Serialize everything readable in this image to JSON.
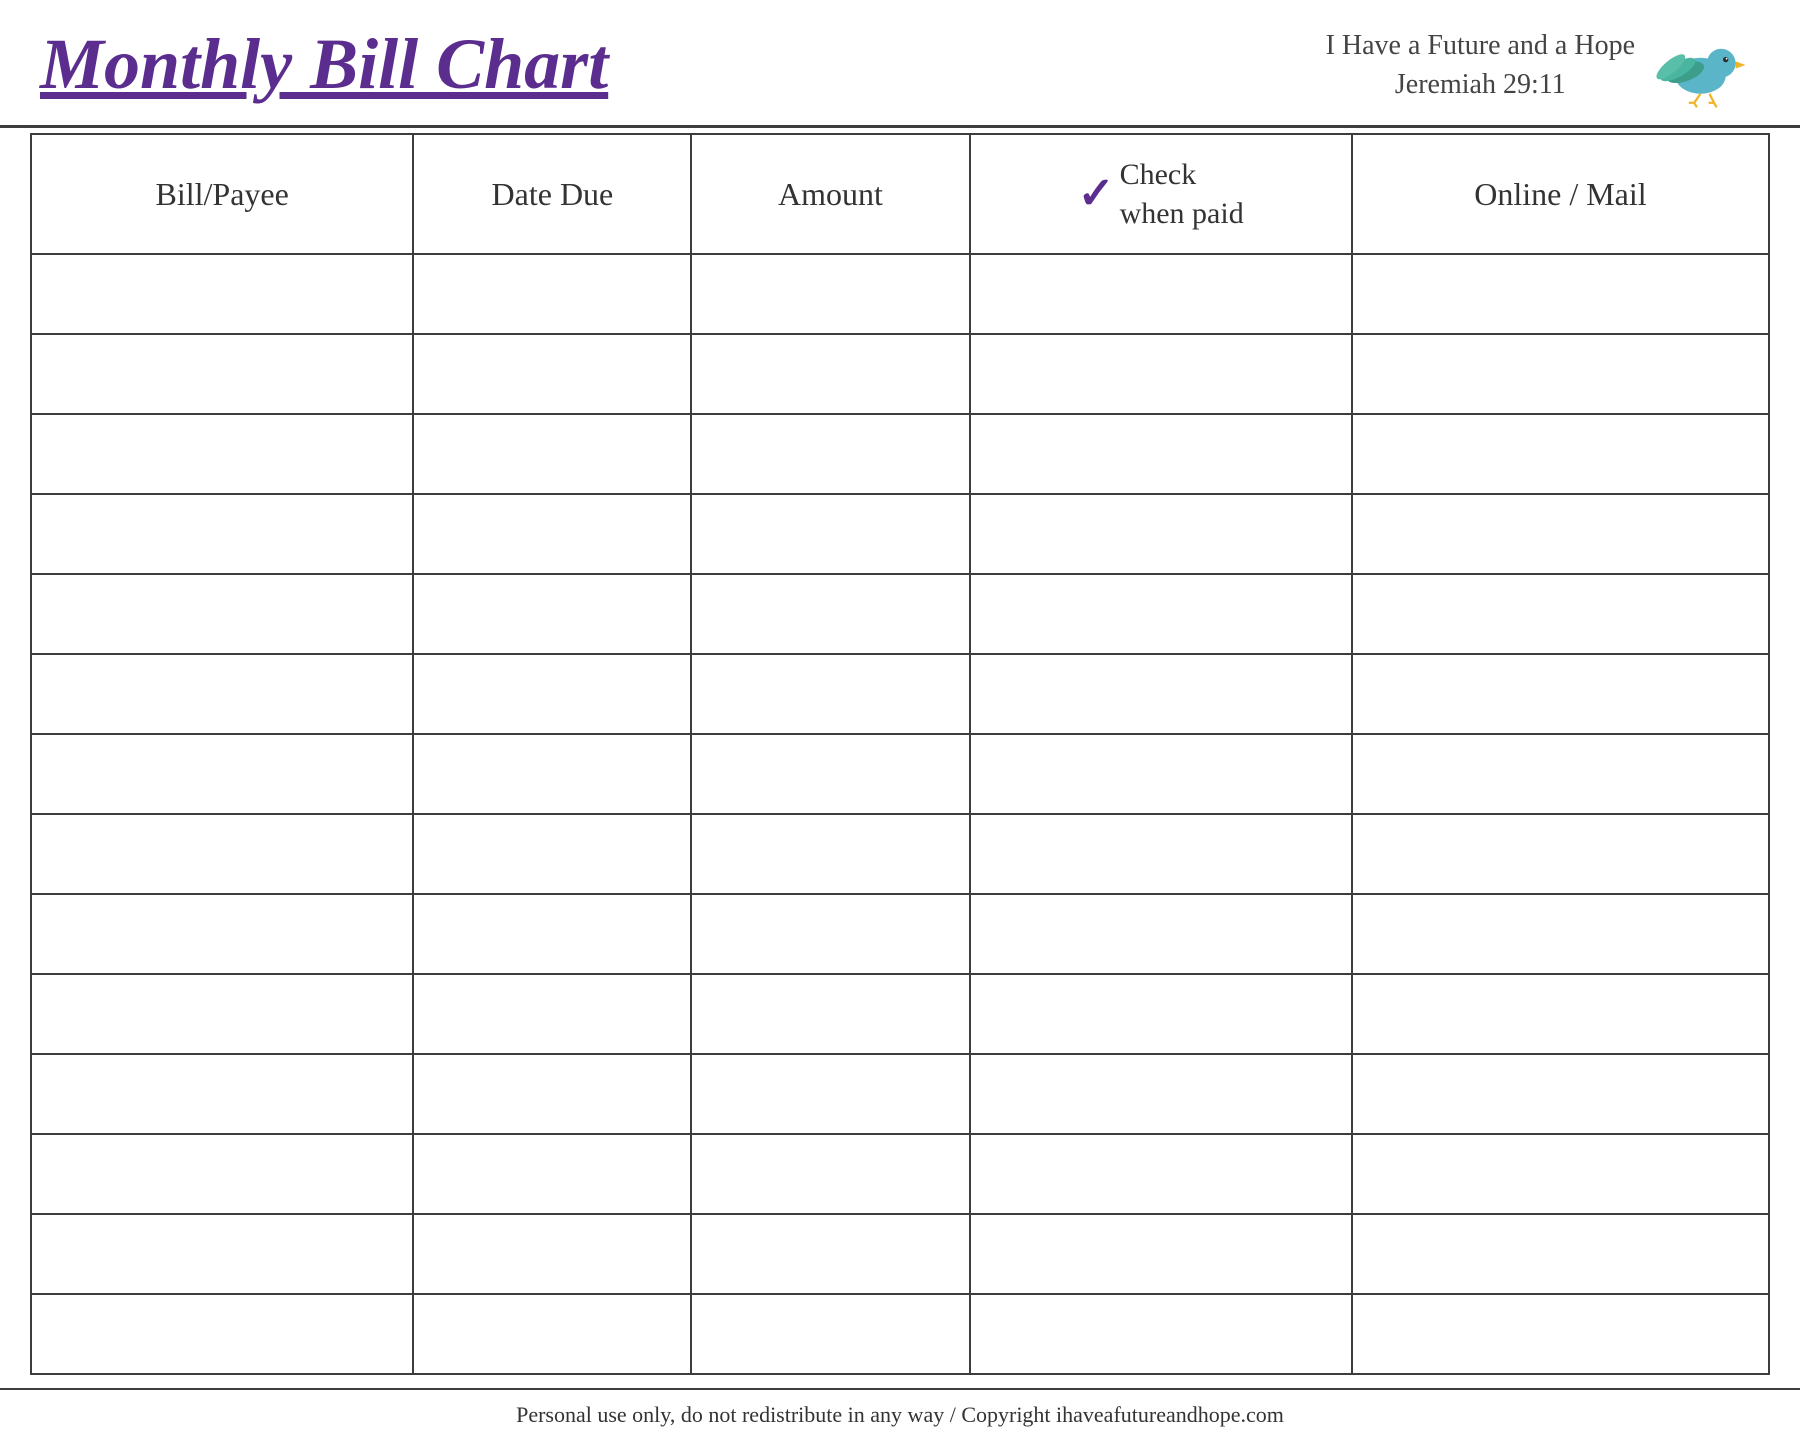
{
  "header": {
    "title": "Monthly Bill Chart",
    "tagline_line1": "I Have a Future and a Hope",
    "tagline_line2": "Jeremiah 29:11"
  },
  "table": {
    "columns": [
      {
        "id": "bill-payee",
        "label": "Bill/Payee"
      },
      {
        "id": "date-due",
        "label": "Date Due"
      },
      {
        "id": "amount",
        "label": "Amount"
      },
      {
        "id": "check-when-paid",
        "label": "when paid",
        "prefix": "Check"
      },
      {
        "id": "online-mail",
        "label": "Online / Mail"
      }
    ],
    "row_count": 14
  },
  "footer": {
    "text": "Personal use only, do not redistribute in any way / Copyright ihaveafutureandhope.com"
  }
}
